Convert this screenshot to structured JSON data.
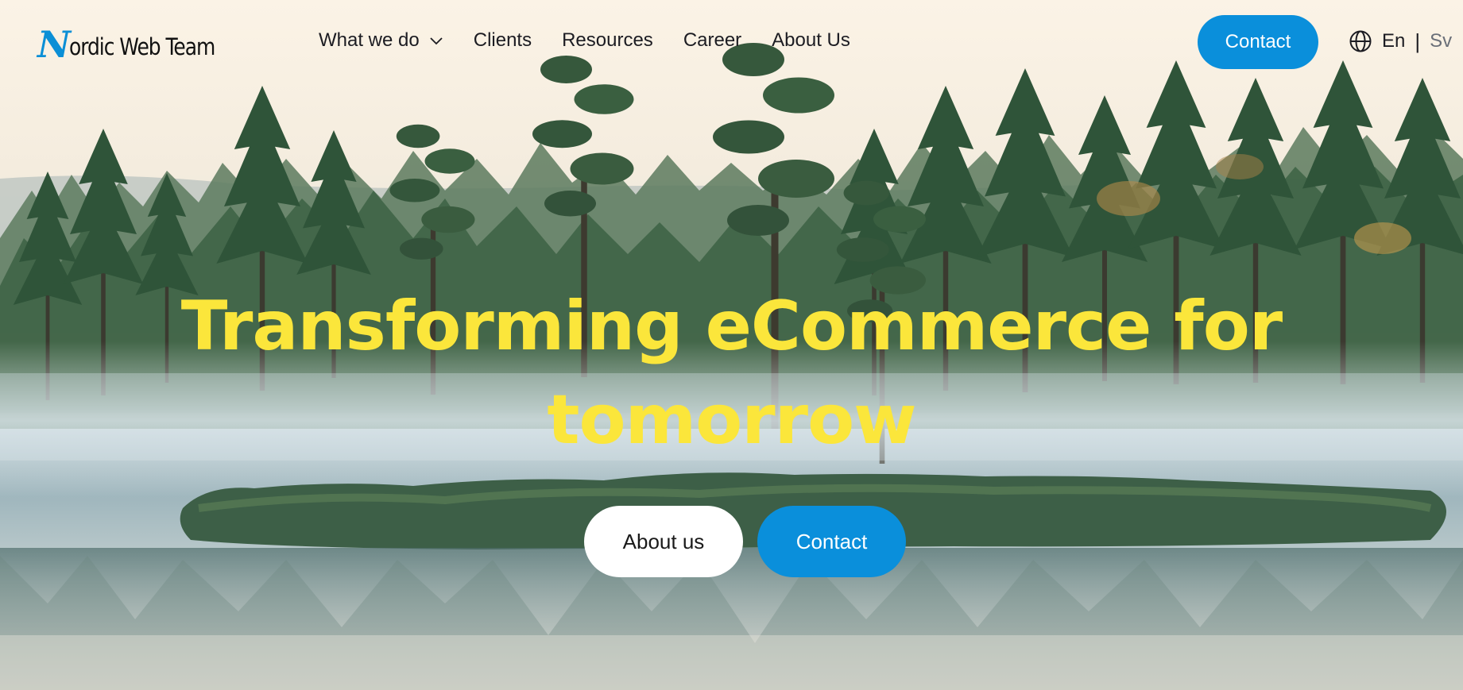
{
  "brand": {
    "logo_letter": "N",
    "logo_rest": "ordic Web Team",
    "accent_color": "#0a8fdb",
    "headline_color": "#fbe63b"
  },
  "nav": {
    "items": [
      {
        "label": "What we do",
        "has_dropdown": true,
        "icon": "chevron-down-icon"
      },
      {
        "label": "Clients"
      },
      {
        "label": "Resources"
      },
      {
        "label": "Career"
      },
      {
        "label": "About Us"
      }
    ],
    "contact_label": "Contact"
  },
  "language": {
    "icon": "globe-icon",
    "current": "En",
    "separator": "|",
    "other": "Sv"
  },
  "hero": {
    "title_line1": "Transforming eCommerce for",
    "title_line2": "tomorrow",
    "about_button": "About us",
    "contact_button": "Contact",
    "background": "misty-forest-lake-photo"
  }
}
